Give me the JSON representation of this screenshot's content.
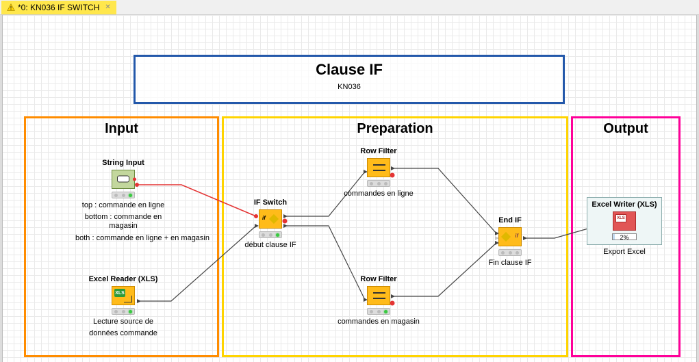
{
  "tab": {
    "label": "*0: KN036 IF SWITCH"
  },
  "title": {
    "heading": "Clause IF",
    "sub": "KN036"
  },
  "zones": {
    "input": "Input",
    "prep": "Preparation",
    "output": "Output"
  },
  "nodes": {
    "string_input": {
      "title": "String Input",
      "caption1": "top : commande en ligne",
      "caption2": "bottom : commande en magasin",
      "caption3": "both : commande en ligne +  en magasin"
    },
    "excel_reader": {
      "title": "Excel Reader (XLS)",
      "caption1": "Lecture source de",
      "caption2": "données commande",
      "badge": "XLS"
    },
    "if_switch": {
      "title": "IF Switch",
      "caption": "début clause IF",
      "label": "if"
    },
    "row_filter_top": {
      "title": "Row Filter",
      "caption": "commandes en ligne"
    },
    "row_filter_bottom": {
      "title": "Row Filter",
      "caption": "commandes en magasin"
    },
    "end_if": {
      "title": "End IF",
      "caption": "Fin clause IF",
      "label": "if"
    },
    "excel_writer": {
      "title": "Excel Writer (XLS)",
      "caption": "Export Excel",
      "badge": "XLS",
      "progress": "2%"
    }
  }
}
